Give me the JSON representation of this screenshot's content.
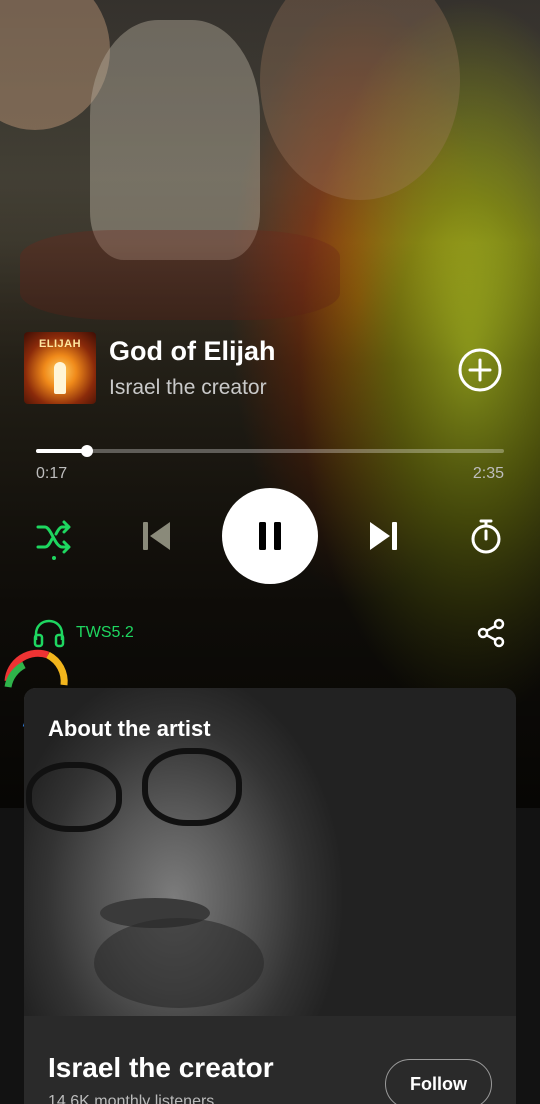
{
  "player": {
    "cover_text": "ELIJAH",
    "title": "God of Elijah",
    "artist": "Israel the creator",
    "progress": 0.11,
    "time_elapsed": "0:17",
    "time_total": "2:35",
    "shuffle_active": true,
    "is_playing": true
  },
  "device": {
    "label": "TWS5.2",
    "icon": "headphones-icon"
  },
  "about_card": {
    "heading": "About the artist",
    "artist_name": "Israel the creator",
    "monthly_listeners": "14.6K monthly listeners",
    "follow_label": "Follow"
  },
  "colors": {
    "accent": "#1ed760",
    "background": "#121212",
    "card": "#2a2a2a"
  }
}
